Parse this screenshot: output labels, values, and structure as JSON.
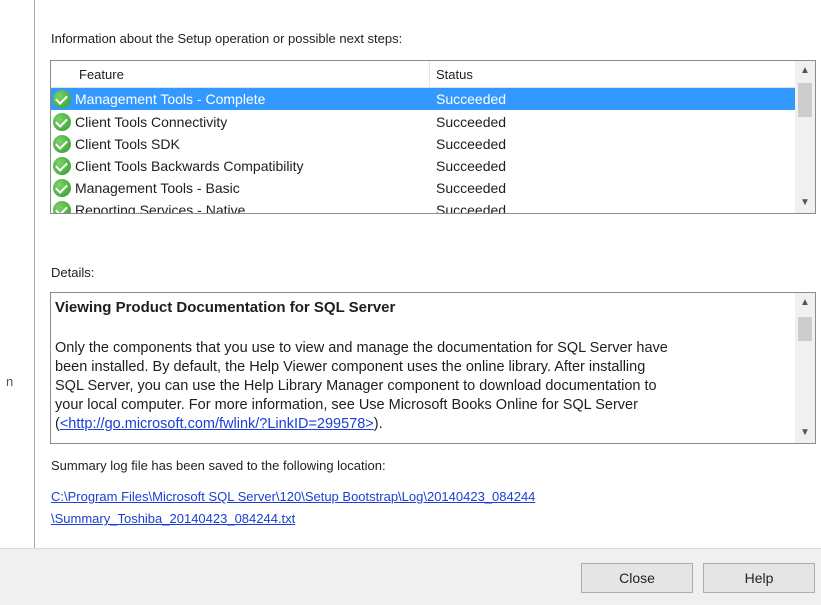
{
  "info_label": "Information about the Setup operation or possible next steps:",
  "features_table": {
    "columns": [
      "Feature",
      "Status"
    ],
    "rows": [
      {
        "feature": "Management Tools - Complete",
        "status": "Succeeded",
        "selected": true
      },
      {
        "feature": "Client Tools Connectivity",
        "status": "Succeeded",
        "selected": false
      },
      {
        "feature": "Client Tools SDK",
        "status": "Succeeded",
        "selected": false
      },
      {
        "feature": "Client Tools Backwards Compatibility",
        "status": "Succeeded",
        "selected": false
      },
      {
        "feature": "Management Tools - Basic",
        "status": "Succeeded",
        "selected": false
      },
      {
        "feature": "Reporting Services - Native",
        "status": "Succeeded",
        "selected": false
      }
    ],
    "icon": "success-check-icon"
  },
  "details_label": "Details:",
  "details": {
    "heading": "Viewing Product Documentation for SQL Server",
    "lines": [
      "Only the components that you use to view and manage the documentation for SQL Server have",
      "been installed. By default, the Help Viewer component uses the online library. After installing",
      "SQL Server, you can use the Help Library Manager component to download documentation to",
      "your local computer. For more information, see Use Microsoft Books Online for SQL Server"
    ],
    "link_prefix": "(",
    "link_text": "<http://go.microsoft.com/fwlink/?LinkID=299578>",
    "link_suffix": ")."
  },
  "summary_label": "Summary log file has been saved to the following location:",
  "log_path": {
    "line1": "C:\\Program Files\\Microsoft SQL Server\\120\\Setup Bootstrap\\Log\\20140423_084244",
    "line2": "\\Summary_Toshiba_20140423_084244.txt"
  },
  "buttons": {
    "close": "Close",
    "help": "Help"
  },
  "colors": {
    "selection": "#3399ff",
    "link": "#1a3fd4",
    "success": "#2f9a2a"
  }
}
